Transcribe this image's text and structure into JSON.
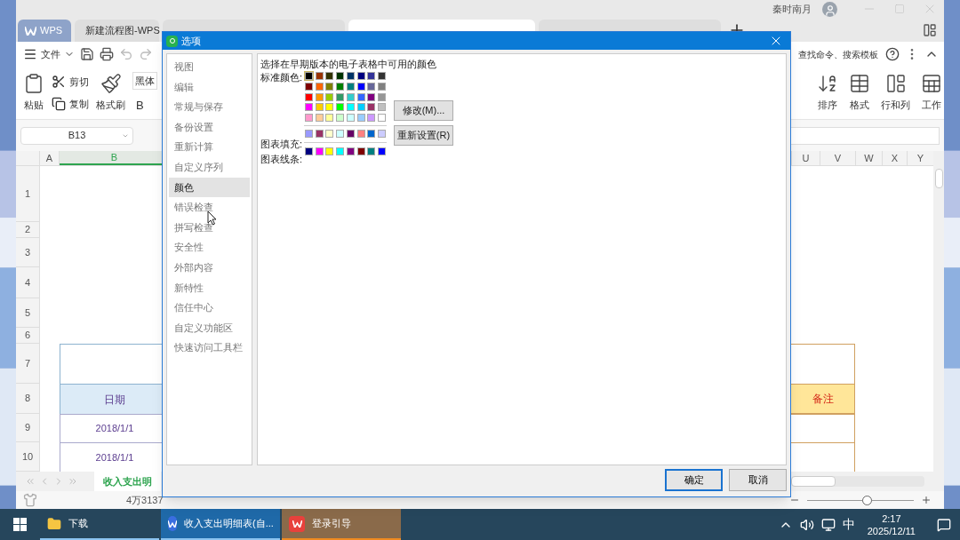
{
  "window": {
    "user": "秦时南月"
  },
  "tabs": [
    {
      "label": "WPS",
      "kind": "home",
      "selected": false
    },
    {
      "label": "新建流程图-WPS",
      "kind": "flow",
      "selected": false
    },
    {
      "kind": "document",
      "selected": false
    },
    {
      "kind": "document",
      "selected": true
    },
    {
      "kind": "document",
      "selected": false
    }
  ],
  "menu": {
    "file": "文件",
    "search": "查找命令、搜索模板"
  },
  "ribbon": {
    "paste": "粘贴",
    "cut": "剪切",
    "copy": "复制",
    "format_painter": "格式刷",
    "font": "黑体",
    "bold": "B",
    "right": [
      {
        "label": "排序",
        "kind": "sort"
      },
      {
        "label": "格式",
        "kind": "format"
      },
      {
        "label": "行和列",
        "kind": "rows"
      },
      {
        "label": "工作",
        "kind": "sheet"
      }
    ]
  },
  "name_box": "B13",
  "columns_left": [
    "A",
    "B"
  ],
  "columns_right": [
    "U",
    "V",
    "W",
    "X",
    "Y"
  ],
  "rows": [
    {
      "number": "1",
      "kind": "blank"
    },
    {
      "number": "2",
      "kind": "blank"
    },
    {
      "number": "3",
      "kind": "blank"
    },
    {
      "number": "4",
      "kind": "blank"
    },
    {
      "number": "5",
      "kind": "blank"
    },
    {
      "number": "6",
      "kind": "blank"
    },
    {
      "number": "7",
      "kind": "title"
    },
    {
      "number": "8",
      "kind": "header",
      "date": "日期",
      "note": "备注"
    },
    {
      "number": "9",
      "kind": "data",
      "date": "2018/1/1"
    },
    {
      "number": "10",
      "kind": "data",
      "date": "2018/1/1"
    }
  ],
  "sheet_tab": "收入支出明",
  "status": "4万3137",
  "zoom_slider": {
    "level": 0.56
  },
  "dialog": {
    "title": "选项",
    "nav": [
      {
        "label": "视图",
        "selected": false
      },
      {
        "label": "编辑",
        "selected": false
      },
      {
        "label": "常规与保存",
        "selected": false
      },
      {
        "label": "备份设置",
        "selected": false
      },
      {
        "label": "重新计算",
        "selected": false
      },
      {
        "label": "自定义序列",
        "selected": false
      },
      {
        "label": "颜色",
        "selected": true
      },
      {
        "label": "错误检查",
        "selected": false
      },
      {
        "label": "拼写检查",
        "selected": false
      },
      {
        "label": "安全性",
        "selected": false
      },
      {
        "label": "外部内容",
        "selected": false
      },
      {
        "label": "新特性",
        "selected": false
      },
      {
        "label": "信任中心",
        "selected": false
      },
      {
        "label": "自定义功能区",
        "selected": false
      },
      {
        "label": "快速访问工具栏",
        "selected": false
      }
    ],
    "heading": "选择在早期版本的电子表格中可用的颜色",
    "standard_label": "标准颜色:",
    "standard_colors": [
      {
        "color": "#000000",
        "selected": true
      },
      {
        "color": "#993300",
        "selected": false
      },
      {
        "color": "#333300",
        "selected": false
      },
      {
        "color": "#003300",
        "selected": false
      },
      {
        "color": "#003366",
        "selected": false
      },
      {
        "color": "#000080",
        "selected": false
      },
      {
        "color": "#333399",
        "selected": false
      },
      {
        "color": "#333333",
        "selected": false
      },
      {
        "color": "#800000",
        "selected": false
      },
      {
        "color": "#ff6600",
        "selected": false
      },
      {
        "color": "#808000",
        "selected": false
      },
      {
        "color": "#008000",
        "selected": false
      },
      {
        "color": "#008080",
        "selected": false
      },
      {
        "color": "#0000ff",
        "selected": false
      },
      {
        "color": "#666699",
        "selected": false
      },
      {
        "color": "#808080",
        "selected": false
      },
      {
        "color": "#ff0000",
        "selected": false
      },
      {
        "color": "#ff9900",
        "selected": false
      },
      {
        "color": "#99cc00",
        "selected": false
      },
      {
        "color": "#339966",
        "selected": false
      },
      {
        "color": "#33cccc",
        "selected": false
      },
      {
        "color": "#3366ff",
        "selected": false
      },
      {
        "color": "#800080",
        "selected": false
      },
      {
        "color": "#969696",
        "selected": false
      },
      {
        "color": "#ff00ff",
        "selected": false
      },
      {
        "color": "#ffcc00",
        "selected": false
      },
      {
        "color": "#ffff00",
        "selected": false
      },
      {
        "color": "#00ff00",
        "selected": false
      },
      {
        "color": "#00ffff",
        "selected": false
      },
      {
        "color": "#00ccff",
        "selected": false
      },
      {
        "color": "#993366",
        "selected": false
      },
      {
        "color": "#c0c0c0",
        "selected": false
      },
      {
        "color": "#ff99cc",
        "selected": false
      },
      {
        "color": "#ffcc99",
        "selected": false
      },
      {
        "color": "#ffff99",
        "selected": false
      },
      {
        "color": "#ccffcc",
        "selected": false
      },
      {
        "color": "#ccffff",
        "selected": false
      },
      {
        "color": "#99ccff",
        "selected": false
      },
      {
        "color": "#cc99ff",
        "selected": false
      },
      {
        "color": "#ffffff",
        "selected": false
      }
    ],
    "chart_fill_label": "图表填充:",
    "chart_fill": [
      {
        "color": "#9999ff"
      },
      {
        "color": "#993366"
      },
      {
        "color": "#ffffcc"
      },
      {
        "color": "#ccffff"
      },
      {
        "color": "#660066"
      },
      {
        "color": "#ff8080"
      },
      {
        "color": "#0066cc"
      },
      {
        "color": "#ccccff"
      }
    ],
    "chart_line_label": "图表线条:",
    "chart_line": [
      {
        "color": "#000080"
      },
      {
        "color": "#ff00ff"
      },
      {
        "color": "#ffff00"
      },
      {
        "color": "#00ffff"
      },
      {
        "color": "#800080"
      },
      {
        "color": "#800000"
      },
      {
        "color": "#008080"
      },
      {
        "color": "#0000ff"
      }
    ],
    "modify": "修改(M)...",
    "reset": "重新设置(R)",
    "ok": "确定",
    "cancel": "取消"
  },
  "taskbar": {
    "items": [
      {
        "label": "下载",
        "kind": "folder",
        "active": false,
        "attention": false
      },
      {
        "label": "收入支出明细表(自...",
        "kind": "wps-doc",
        "active": true,
        "attention": false
      },
      {
        "label": "登录引导",
        "kind": "wps",
        "active": false,
        "attention": true
      }
    ],
    "ime": "中",
    "time": "2:17",
    "date": "2025/12/11"
  }
}
